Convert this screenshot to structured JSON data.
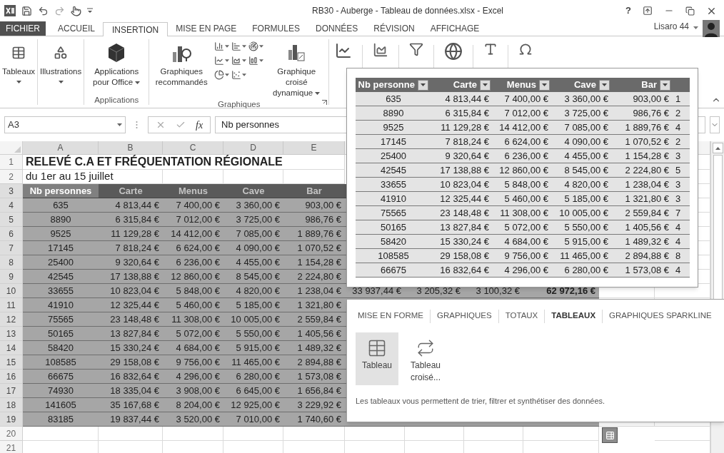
{
  "window": {
    "title": "RB30 - Auberge - Tableau de données.xlsx - Excel",
    "help": "?"
  },
  "ribbon_tabs": [
    {
      "label": "FICHIER",
      "kind": "file",
      "selected": false
    },
    {
      "label": "ACCUEIL",
      "kind": "tab",
      "selected": false
    },
    {
      "label": "INSERTION",
      "kind": "tab",
      "selected": true
    },
    {
      "label": "MISE EN PAGE",
      "kind": "tab",
      "selected": false
    },
    {
      "label": "FORMULES",
      "kind": "tab",
      "selected": false
    },
    {
      "label": "DONNÉES",
      "kind": "tab",
      "selected": false
    },
    {
      "label": "RÉVISION",
      "kind": "tab",
      "selected": false
    },
    {
      "label": "AFFICHAGE",
      "kind": "tab",
      "selected": false
    }
  ],
  "account": {
    "name": "Lisaro 44"
  },
  "ribbon": {
    "groups": [
      {
        "buttons": [
          {
            "label": "Tableaux",
            "kind": "stacked",
            "dropdown": true
          }
        ]
      },
      {
        "buttons": [
          {
            "label": "Illustrations",
            "kind": "stacked",
            "dropdown": true
          }
        ]
      },
      {
        "label": "Applications",
        "buttons": [
          {
            "label": "Applications pour Office",
            "kind": "inline",
            "dropdown": true
          }
        ]
      },
      {
        "label": "Graphiques",
        "buttons": [
          {
            "label": "Graphiques recommandés",
            "kind": "inline",
            "dropdown": false
          },
          {
            "label": "Graphique croisé dynamique",
            "kind": "inline",
            "dropdown": true
          }
        ]
      }
    ]
  },
  "formula_bar": {
    "name_box": "A3",
    "function_label": "fx",
    "formula": "Nb personnes"
  },
  "sheet": {
    "columns": [
      "A",
      "B",
      "C",
      "D",
      "E"
    ],
    "row_numbers": [
      "1",
      "2",
      "3",
      "4",
      "5",
      "6",
      "7",
      "8",
      "9",
      "10",
      "11",
      "12",
      "13",
      "14",
      "15",
      "16",
      "17",
      "18",
      "19",
      "20",
      "21"
    ],
    "title": "RELEVÉ C.A ET FRÉQUENTATION RÉGIONALE",
    "subtitle": "du 1er au 15 juillet",
    "table": {
      "headers": [
        {
          "label": "Nb personnes",
          "selected": true
        },
        {
          "label": "Carte",
          "selected": false
        },
        {
          "label": "Menus",
          "selected": false
        },
        {
          "label": "Cave",
          "selected": false
        },
        {
          "label": "Bar",
          "selected": false
        }
      ],
      "rows": [
        {
          "cells": [
            "635",
            "4 813,44 €",
            "7 400,00 €",
            "3 360,00 €",
            "903,00 €"
          ]
        },
        {
          "cells": [
            "8890",
            "6 315,84 €",
            "7 012,00 €",
            "3 725,00 €",
            "986,76 €"
          ]
        },
        {
          "cells": [
            "9525",
            "11 129,28 €",
            "14 412,00 €",
            "7 085,00 €",
            "1 889,76 €"
          ]
        },
        {
          "cells": [
            "17145",
            "7 818,24 €",
            "6 624,00 €",
            "4 090,00 €",
            "1 070,52 €"
          ]
        },
        {
          "cells": [
            "25400",
            "9 320,64 €",
            "6 236,00 €",
            "4 455,00 €",
            "1 154,28 €"
          ]
        },
        {
          "cells": [
            "42545",
            "17 138,88 €",
            "12 860,00 €",
            "8 545,00 €",
            "2 224,80 €"
          ]
        },
        {
          "cells": [
            "33655",
            "10 823,04 €",
            "5 848,00 €",
            "4 820,00 €",
            "1 238,04 €"
          ],
          "extra_cells": [
            {
              "text": "33 937,44 €",
              "bold": false
            },
            {
              "text": "3 205,32 €",
              "bold": false
            },
            {
              "text": "3 100,32 €",
              "bold": false
            },
            {
              "text": "62 972,16 €",
              "bold": true
            }
          ]
        },
        {
          "cells": [
            "41910",
            "12 325,44 €",
            "5 460,00 €",
            "5 185,00 €",
            "1 321,80 €"
          ]
        },
        {
          "cells": [
            "75565",
            "23 148,48 €",
            "11 308,00 €",
            "10 005,00 €",
            "2 559,84 €"
          ]
        },
        {
          "cells": [
            "50165",
            "13 827,84 €",
            "5 072,00 €",
            "5 550,00 €",
            "1 405,56 €"
          ]
        },
        {
          "cells": [
            "58420",
            "15 330,24 €",
            "4 684,00 €",
            "5 915,00 €",
            "1 489,32 €"
          ]
        },
        {
          "cells": [
            "108585",
            "29 158,08 €",
            "9 756,00 €",
            "11 465,00 €",
            "2 894,88 €"
          ]
        },
        {
          "cells": [
            "66675",
            "16 832,64 €",
            "4 296,00 €",
            "6 280,00 €",
            "1 573,08 €"
          ]
        },
        {
          "cells": [
            "74930",
            "18 335,04 €",
            "3 908,00 €",
            "6 645,00 €",
            "1 656,84 €"
          ]
        },
        {
          "cells": [
            "141605",
            "35 167,68 €",
            "8 204,00 €",
            "12 925,00 €",
            "3 229,92 €"
          ]
        },
        {
          "cells": [
            "83185",
            "19 837,44 €",
            "3 520,00 €",
            "7 010,00 €",
            "1 740,60 €"
          ]
        }
      ]
    }
  },
  "preview": {
    "headers": [
      "Nb personne",
      "Carte",
      "Menus",
      "Cave",
      "Bar"
    ],
    "rows": [
      {
        "cells": [
          "635",
          "4 813,44 €",
          "7 400,00 €",
          "3 360,00 €",
          "903,00 €"
        ],
        "column_6": "1"
      },
      {
        "cells": [
          "8890",
          "6 315,84 €",
          "7 012,00 €",
          "3 725,00 €",
          "986,76 €"
        ],
        "column_6": "2"
      },
      {
        "cells": [
          "9525",
          "11 129,28 €",
          "14 412,00 €",
          "7 085,00 €",
          "1 889,76 €"
        ],
        "column_6": "4"
      },
      {
        "cells": [
          "17145",
          "7 818,24 €",
          "6 624,00 €",
          "4 090,00 €",
          "1 070,52 €"
        ],
        "column_6": "2"
      },
      {
        "cells": [
          "25400",
          "9 320,64 €",
          "6 236,00 €",
          "4 455,00 €",
          "1 154,28 €"
        ],
        "column_6": "3"
      },
      {
        "cells": [
          "42545",
          "17 138,88 €",
          "12 860,00 €",
          "8 545,00 €",
          "2 224,80 €"
        ],
        "column_6": "5"
      },
      {
        "cells": [
          "33655",
          "10 823,04 €",
          "5 848,00 €",
          "4 820,00 €",
          "1 238,04 €"
        ],
        "column_6": "3"
      },
      {
        "cells": [
          "41910",
          "12 325,44 €",
          "5 460,00 €",
          "5 185,00 €",
          "1 321,80 €"
        ],
        "column_6": "3"
      },
      {
        "cells": [
          "75565",
          "23 148,48 €",
          "11 308,00 €",
          "10 005,00 €",
          "2 559,84 €"
        ],
        "column_6": "7"
      },
      {
        "cells": [
          "50165",
          "13 827,84 €",
          "5 072,00 €",
          "5 550,00 €",
          "1 405,56 €"
        ],
        "column_6": "4"
      },
      {
        "cells": [
          "58420",
          "15 330,24 €",
          "4 684,00 €",
          "5 915,00 €",
          "1 489,32 €"
        ],
        "column_6": "4"
      },
      {
        "cells": [
          "108585",
          "29 158,08 €",
          "9 756,00 €",
          "11 465,00 €",
          "2 894,88 €"
        ],
        "column_6": "8"
      },
      {
        "cells": [
          "66675",
          "16 832,64 €",
          "4 296,00 €",
          "6 280,00 €",
          "1 573,08 €"
        ],
        "column_6": "4"
      }
    ]
  },
  "quick_analysis": {
    "tabs": [
      {
        "label": "MISE EN FORME",
        "selected": false
      },
      {
        "label": "GRAPHIQUES",
        "selected": false
      },
      {
        "label": "TOTAUX",
        "selected": false
      },
      {
        "label": "TABLEAUX",
        "selected": true
      },
      {
        "label": "GRAPHIQUES SPARKLINE",
        "selected": false
      }
    ],
    "options": [
      {
        "label": "Tableau",
        "kind": "table",
        "selected": true
      },
      {
        "label": "Tableau croisé...",
        "kind": "pivot",
        "selected": false
      }
    ],
    "description": "Les tableaux vous permettent de trier, filtrer et synthétiser des données."
  }
}
